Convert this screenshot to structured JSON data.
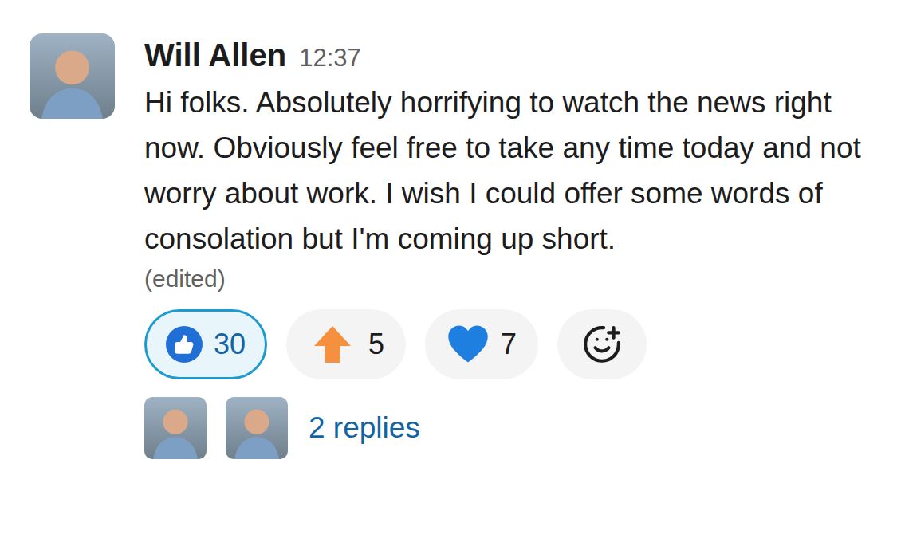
{
  "message": {
    "author": "Will Allen",
    "time": "12:37",
    "text": "Hi folks. Absolutely horrifying to watch the news right now. Obviously feel free to take any time today and not worry about work. I wish I could offer some words of consolation but I'm coming up short.",
    "edited": "(edited)"
  },
  "reactions": [
    {
      "kind": "thumbsup",
      "count": "30",
      "selected": true
    },
    {
      "kind": "arrow",
      "count": "5",
      "selected": false
    },
    {
      "kind": "heart",
      "count": "7",
      "selected": false
    }
  ],
  "replies": {
    "label": "2 replies"
  }
}
